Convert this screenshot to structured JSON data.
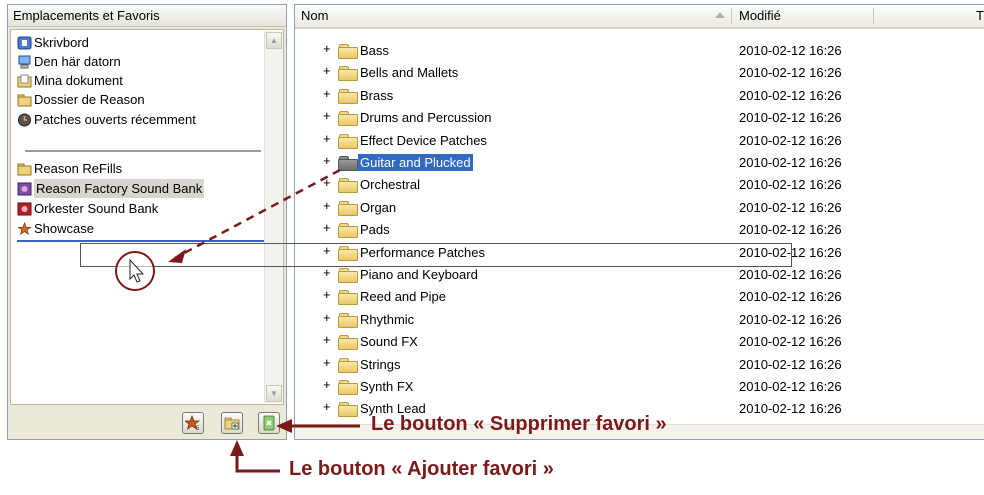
{
  "left_panel": {
    "header": "Emplacements et Favoris",
    "locations": [
      {
        "label": "Skrivbord",
        "icon": "desktop-icon"
      },
      {
        "label": "Den här datorn",
        "icon": "computer-icon"
      },
      {
        "label": "Mina dokument",
        "icon": "documents-folder-icon"
      },
      {
        "label": "Dossier de Reason",
        "icon": "folder-icon"
      },
      {
        "label": "Patches ouverts récemment",
        "icon": "recent-patches-icon"
      }
    ],
    "favorites": [
      {
        "label": "Reason ReFills",
        "icon": "folder-icon",
        "selected": false
      },
      {
        "label": "Reason Factory Sound Bank",
        "icon": "refill-icon",
        "selected": true
      },
      {
        "label": "Orkester Sound Bank",
        "icon": "refill-red-icon",
        "selected": false
      },
      {
        "label": "Showcase",
        "icon": "star-icon",
        "selected": false
      }
    ],
    "toolbar_buttons": [
      {
        "name": "showcase-button",
        "icon": "star-icon"
      },
      {
        "name": "add-favorite-button",
        "icon": "add-folder-icon"
      },
      {
        "name": "remove-favorite-button",
        "icon": "remove-favorite-icon"
      }
    ]
  },
  "browser": {
    "columns": {
      "name": "Nom",
      "modified": "Modifié",
      "third": "T"
    },
    "rows": [
      {
        "name": "Bass",
        "date": "2010-02-12 16:26",
        "selected": false
      },
      {
        "name": "Bells and Mallets",
        "date": "2010-02-12 16:26",
        "selected": false
      },
      {
        "name": "Brass",
        "date": "2010-02-12 16:26",
        "selected": false
      },
      {
        "name": "Drums and Percussion",
        "date": "2010-02-12 16:26",
        "selected": false
      },
      {
        "name": "Effect Device Patches",
        "date": "2010-02-12 16:26",
        "selected": false
      },
      {
        "name": "Guitar and Plucked",
        "date": "2010-02-12 16:26",
        "selected": true
      },
      {
        "name": "Orchestral",
        "date": "2010-02-12 16:26",
        "selected": false
      },
      {
        "name": "Organ",
        "date": "2010-02-12 16:26",
        "selected": false
      },
      {
        "name": "Pads",
        "date": "2010-02-12 16:26",
        "selected": false
      },
      {
        "name": "Performance Patches",
        "date": "2010-02-12 16:26",
        "selected": false
      },
      {
        "name": "Piano and Keyboard",
        "date": "2010-02-12 16:26",
        "selected": false
      },
      {
        "name": "Reed and Pipe",
        "date": "2010-02-12 16:26",
        "selected": false
      },
      {
        "name": "Rhythmic",
        "date": "2010-02-12 16:26",
        "selected": false
      },
      {
        "name": "Sound FX",
        "date": "2010-02-12 16:26",
        "selected": false
      },
      {
        "name": "Strings",
        "date": "2010-02-12 16:26",
        "selected": false
      },
      {
        "name": "Synth FX",
        "date": "2010-02-12 16:26",
        "selected": false
      },
      {
        "name": "Synth Lead",
        "date": "2010-02-12 16:26",
        "selected": false
      }
    ],
    "expander_symbol": "+"
  },
  "annotations": {
    "remove_favorite": "Le bouton « Supprimer favori »",
    "add_favorite": "Le bouton « Ajouter favori »"
  },
  "colors": {
    "selection": "#316ac5",
    "annotation": "#7a1a1a",
    "drop_indicator": "#3d62c6"
  }
}
